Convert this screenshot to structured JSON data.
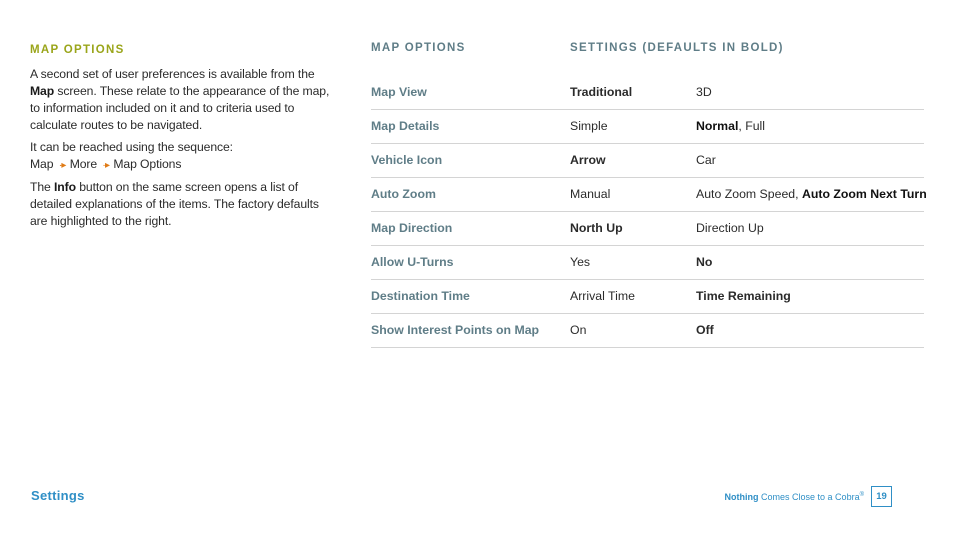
{
  "left": {
    "title": "MAP OPTIONS",
    "p1_a": "A second set of user preferences is available from the ",
    "p1_bold": "Map",
    "p1_b": " screen. These relate to the appearance of the map, to information included on it and to criteria used to calculate routes to be navigated.",
    "p2_line1": "It can be reached using the sequence:",
    "p2_seq": [
      "Map",
      "More",
      "Map Options"
    ],
    "p2_arrow_icon": "dotted-arrow-right-icon",
    "p3_a": "The ",
    "p3_bold": "Info",
    "p3_b": " button on the same screen opens a list of detailed explanations of the items. The factory defaults are highlighted to the right."
  },
  "table": {
    "header1": "MAP OPTIONS",
    "header2": "SETTINGS (DEFAULTS IN BOLD)",
    "rows": [
      {
        "name": "Map View",
        "opt1": "Traditional",
        "opt2": "3D",
        "default": "opt1"
      },
      {
        "name": "Map Details",
        "opt1": "Simple",
        "opt2_bold": "Normal",
        "opt2_rest": ", Full",
        "default": "opt2"
      },
      {
        "name": "Vehicle Icon",
        "opt1": "Arrow",
        "opt2": "Car",
        "default": "opt1"
      },
      {
        "name": "Auto Zoom",
        "opt1": "Manual",
        "opt2_plain": "Auto Zoom Speed, ",
        "opt2_bold": "Auto Zoom Next Turn",
        "default": "opt2"
      },
      {
        "name": "Map Direction",
        "opt1": "North Up",
        "opt2": "Direction Up",
        "default": "opt1"
      },
      {
        "name": "Allow U-Turns",
        "opt1": "Yes",
        "opt2": "No",
        "default": "opt2"
      },
      {
        "name": "Destination Time",
        "opt1": "Arrival Time",
        "opt2": "Time Remaining",
        "default": "opt2"
      },
      {
        "name": "Show Interest Points on Map",
        "opt1": "On",
        "opt2": "Off",
        "default": "opt2"
      }
    ]
  },
  "footer": {
    "section": "Settings",
    "tagline_bold": "Nothing",
    "tagline_rest": " Comes Close to a Cobra",
    "trademark": "®",
    "page_number": "19"
  },
  "colors": {
    "accent_green": "#9aa51a",
    "header_teal": "#5f7d87",
    "arrow_orange": "#e07b16",
    "footer_blue": "#2f8fc6"
  }
}
